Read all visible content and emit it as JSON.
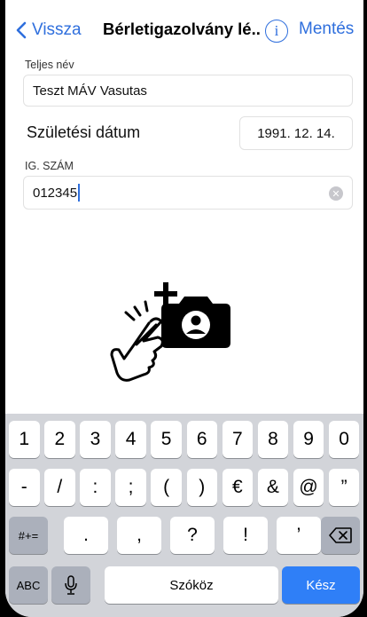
{
  "nav": {
    "back_label": "Vissza",
    "title": "Bérletigazolvány lé...",
    "info_symbol": "i",
    "save_label": "Mentés"
  },
  "form": {
    "full_name_label": "Teljes név",
    "full_name_value": "Teszt MÁV Vasutas",
    "dob_label": "Születési dátum",
    "dob_value": "1991. 12. 14.",
    "id_label": "IG. SZÁM",
    "id_value": "012345"
  },
  "illustration": {
    "icons": [
      "tap-hand-icon",
      "add-photo-camera-icon"
    ]
  },
  "keyboard": {
    "row1": [
      "1",
      "2",
      "3",
      "4",
      "5",
      "6",
      "7",
      "8",
      "9",
      "0"
    ],
    "row2": [
      "-",
      "/",
      ":",
      ";",
      "(",
      ")",
      "€",
      "&",
      "@",
      "”"
    ],
    "row3": [
      ".",
      ",",
      "?",
      "!",
      "’"
    ],
    "symbols_toggle": "#+=",
    "abc_label": "ABC",
    "space_label": "Szóköz",
    "done_label": "Kész"
  },
  "colors": {
    "accent": "#2f6fdd",
    "done_key": "#2f7ff7",
    "keyboard_bg": "#d2d4d9"
  }
}
